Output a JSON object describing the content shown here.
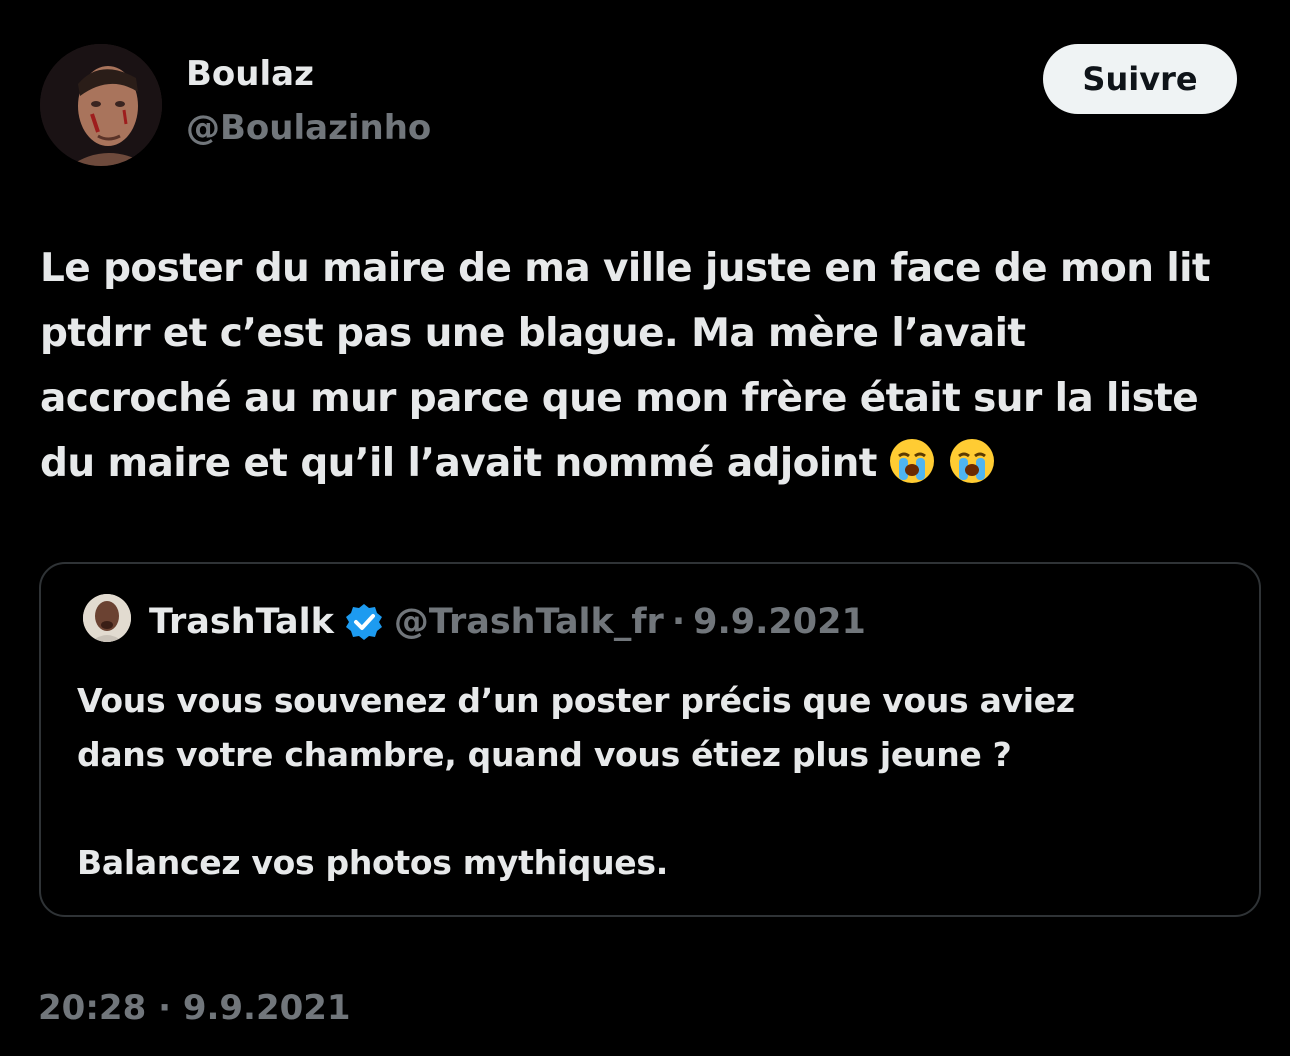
{
  "author": {
    "name": "Boulaz",
    "handle": "@Boulazinho",
    "follow_label": "Suivre"
  },
  "tweet": {
    "lines": [
      "Le poster du maire de ma ville juste en face de mon lit",
      "ptdrr et c’est pas une blague. Ma mère l’avait",
      "accroché au mur parce que mon frère était sur la liste",
      "du maire et qu’il l’avait nommé adjoint"
    ],
    "emojis": [
      "loudly-crying-face-icon",
      "loudly-crying-face-icon"
    ],
    "timestamp": "20:28 · 9.9.2021"
  },
  "quote": {
    "name": "TrashTalk",
    "verified_icon": "verified-badge-icon",
    "handle": "@TrashTalk_fr",
    "separator": "·",
    "date": "9.9.2021",
    "paragraph1": [
      "Vous vous souvenez d’un poster précis que vous aviez",
      "dans votre chambre, quand vous étiez plus jeune ?"
    ],
    "paragraph2": "Balancez vos photos mythiques."
  },
  "colors": {
    "background": "#000000",
    "primary_text": "#e7e9ea",
    "secondary_text": "#71767b",
    "border": "#2f3336",
    "verified": "#1d9bf0",
    "button_bg": "#eff3f4"
  }
}
